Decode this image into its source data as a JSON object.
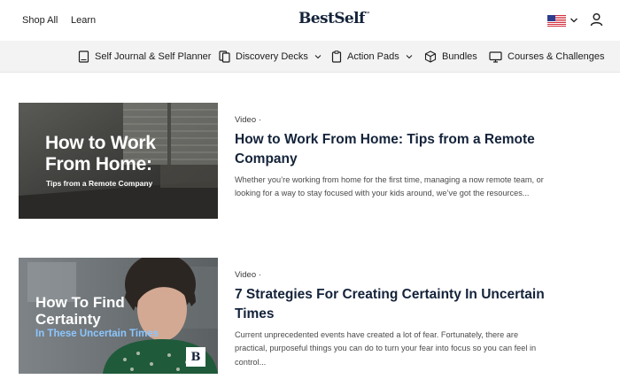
{
  "header": {
    "links": [
      "Shop All",
      "Learn"
    ],
    "logo": "BestSelf",
    "logo_mark": "™",
    "locale_icon": "us-flag-icon",
    "account_icon": "user-icon"
  },
  "nav": {
    "items": [
      {
        "label": "Self Journal & Self Planner",
        "icon": "journal-icon",
        "has_dropdown": false
      },
      {
        "label": "Discovery Decks",
        "icon": "cards-icon",
        "has_dropdown": true
      },
      {
        "label": "Action Pads",
        "icon": "clipboard-icon",
        "has_dropdown": true
      },
      {
        "label": "Bundles",
        "icon": "box-icon",
        "has_dropdown": false
      },
      {
        "label": "Courses & Challenges",
        "icon": "monitor-icon",
        "has_dropdown": false
      }
    ]
  },
  "articles": [
    {
      "meta": "Video ·",
      "title": "How to Work From Home: Tips from a Remote Company",
      "excerpt": "Whether you’re working from home for the first time, managing a now remote team, or looking for a way to stay focused with your kids around, we’ve got the resources...",
      "thumb_title_line1": "How to Work",
      "thumb_title_line2": "From Home:",
      "thumb_subtitle": "Tips from a Remote Company"
    },
    {
      "meta": "Video ·",
      "title": "7 Strategies For Creating Certainty In Uncertain Times",
      "excerpt": "Current unprecedented events have created a lot of fear. Fortunately, there are practical, purposeful things you can do to turn your fear into focus so you can feel in control...",
      "thumb_title_line1": "How To Find",
      "thumb_title_line2": "Certainty",
      "thumb_subtitle": "In These Uncertain Times",
      "thumb_badge": "B"
    }
  ],
  "colors": {
    "brand_navy": "#14233a",
    "nav_background": "#f3f3f3",
    "thumb_subtitle_blue": "#8cc6ff"
  }
}
